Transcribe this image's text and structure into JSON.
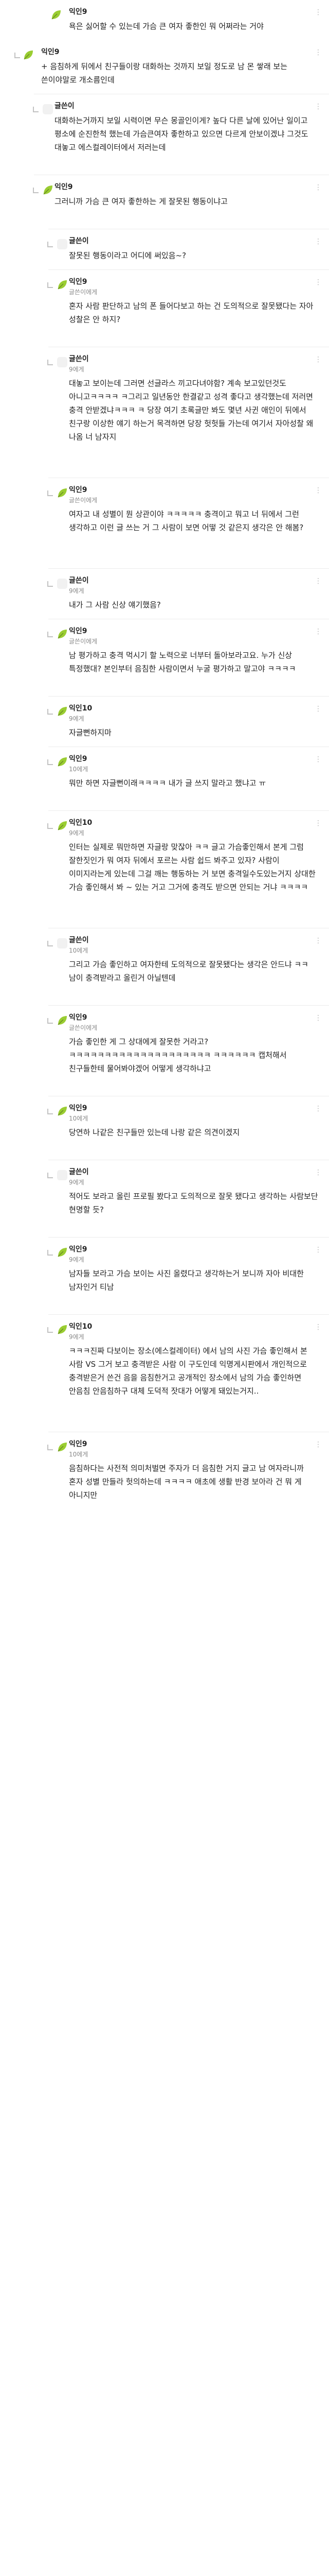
{
  "colors": {
    "avatar_green": "#9acd32",
    "avatar_yellow": "#ffd400",
    "avatar_gray": "#b8b8b8"
  },
  "comments": [
    {
      "depth": 0,
      "avatar": "leaf-avatar",
      "nick": "익인9",
      "reply_to": "",
      "body": "욕은 싫어할 수 있는데 가슴 큰 여자 좋한인 뭐 어쩌라는 거야",
      "time": "",
      "sep": false,
      "lines": 1
    },
    {
      "depth": 1,
      "avatar": "leaf-avatar",
      "nick": "익인9",
      "reply_to": "",
      "body": "+ 음침하게 뒤에서 친구들이랑 대화하는 것까지 보일 정도로 남 몬 쌓래 보는 쓴이야말로 개소름인데",
      "time": "",
      "sep": false,
      "lines": 2
    },
    {
      "depth": 2,
      "avatar": "blank-avatar",
      "nick": "글쓴이",
      "reply_to": "",
      "body": "대화하는거까지 보일 시력이면 무슨 몽골인이게? 높다 다른 날에 있어난 일이고 평소에 순진한척 했는데 가슴큰여자 좋한하고 있으면 다르게 안보이겠냐 그것도 대놓고 에스컬레이터에서 저러는데",
      "time": "",
      "sep": true,
      "lines": 4
    },
    {
      "depth": 2,
      "avatar": "leaf-avatar",
      "nick": "익인9",
      "reply_to": "",
      "body": "그러니까 가슴 큰 여자 좋한하는 게 잘못된 행동이냐고",
      "time": "",
      "sep": true,
      "lines": 2
    },
    {
      "depth": 3,
      "avatar": "blank-avatar",
      "nick": "글쓴이",
      "reply_to": "",
      "body": "잘못된 행동이라고 어디에 써있음~?",
      "time": "",
      "sep": true,
      "lines": 1
    },
    {
      "depth": 3,
      "avatar": "leaf-avatar",
      "nick": "익인9",
      "reply_to": "글쓴이에게",
      "body": "혼자 사람 판단하고 남의 폰 들어다보고 하는 건 도의적으로 잘못됐다는 자아 성찰은 안 하지?",
      "time": "",
      "sep": true,
      "lines": 3
    },
    {
      "depth": 3,
      "avatar": "blank-avatar",
      "nick": "글쓴이",
      "reply_to": "9에게",
      "body": "대놓고 보이는데 그러면 선글라스 끼고다녀야함? 계속 보고있던것도 아니고ㅋㅋㅋㅋ ㅋ그리고 일년동안 한결같고 성격 좋다고 생각했는데 저러면 충격 안받겠냐ㅋㅋㅋ ㅋ 당장 여기 초록글만 봐도 몇년 사귄 애인이 뒤에서 친구랑 이상한 얘기 하는거 목격하면 당장 헛헛들 가는데 여기서 자아성찰 왜 나옴 너 남자지",
      "time": "",
      "sep": true,
      "lines": 7
    },
    {
      "depth": 3,
      "avatar": "leaf-avatar",
      "nick": "익인9",
      "reply_to": "글쓴이에게",
      "body": "여자고 내 성별이 뭔 상관이야 ㅋㅋㅋㅋㅋ 충격이고 뭐고 너 뒤에서 그런 생각하고 이런 글 쓰는 거 그 사람이 보면 어떻 것 같은지 생각은 안 해봄?",
      "time": "",
      "sep": true,
      "lines": 4
    },
    {
      "depth": 3,
      "avatar": "blank-avatar",
      "nick": "글쓴이",
      "reply_to": "9에게",
      "body": "내가 그 사람 신상 얘기했음?",
      "time": "",
      "sep": true,
      "lines": 1
    },
    {
      "depth": 3,
      "avatar": "leaf-avatar",
      "nick": "익인9",
      "reply_to": "글쓴이에게",
      "body": "남 평가하고 충격 먹시기 할 노력으로 너부터 돌아보라고요. 누가 신상 특정했대? 본인부터 음침한 사람이면서 누굴 평가하고 말고야 ㅋㅋㅋㅋ",
      "time": "",
      "sep": true,
      "lines": 3
    },
    {
      "depth": 3,
      "avatar": "leaf-avatar",
      "nick": "익인10",
      "reply_to": "9에게",
      "body": "자글뻔하지마",
      "time": "",
      "sep": true,
      "lines": 1
    },
    {
      "depth": 3,
      "avatar": "leaf-avatar",
      "nick": "익인9",
      "reply_to": "10에게",
      "body": "뭐만 하면 자글뻔이래ㅋㅋㅋㅋ 내가 글 쓰지 말라고 했냐고 ㅠ",
      "time": "",
      "sep": true,
      "lines": 2
    },
    {
      "depth": 3,
      "avatar": "leaf-avatar",
      "nick": "익인10",
      "reply_to": "9에게",
      "body": "인터는 실제로 뭐만하면 자글랑 맞잖아 ㅋㅋ 글고 가슴좋인해서 본게 그럼 잘한짓인가 뭐 여자 뒤에서 포르는 사람 쉽드 봐주고 있자? 사람이 이미지라는게 있는데 그걸 깨는 행동하는 거 보면 충격일수도있는거지 상대한 가슴 좋인해서 봐 ~ 있는 거고 그거에 충격도 받으면 안되는 거냐 ㅋㅋㅋㅋ",
      "time": "",
      "sep": true,
      "lines": 6
    },
    {
      "depth": 3,
      "avatar": "blank-avatar",
      "nick": "글쓴이",
      "reply_to": "10에게",
      "body": "그리고 가슴 좋인하고 여자한테 도의적으로 잘못됐다는 생각은 안드냐 ㅋㅋ 남이 충격받라고 올린거 아닐텐데",
      "time": "",
      "sep": true,
      "lines": 3
    },
    {
      "depth": 3,
      "avatar": "leaf-avatar",
      "nick": "익인9",
      "reply_to": "글쓴이에게",
      "body": "가슴 좋인한 게 그 상대에게 잘못한 거라고? ㅋㅋㅋㅋㅋㅋㅋㅋㅋㅋㅋㅋㅋㅋㅋㅋㅋㅋㅋㅋ ㅋㅋㅋㅋㅋㅋ 캡처해서 친구들한테 물어봐야겠어 어떻게 생각하냐고",
      "time": "",
      "sep": true,
      "lines": 4
    },
    {
      "depth": 3,
      "avatar": "leaf-avatar",
      "nick": "익인9",
      "reply_to": "10에게",
      "body": "당연하 나같은 친구들만 있는데 나랑 같은 의견이겠지",
      "time": "",
      "sep": true,
      "lines": 2
    },
    {
      "depth": 3,
      "avatar": "blank-avatar",
      "nick": "글쓴이",
      "reply_to": "9에게",
      "body": "적어도 보라고 올린 프로필 봤다고 도의적으로 잘못 됐다고 생각하는 사람보단 현명할 듯?",
      "time": "",
      "sep": true,
      "lines": 3
    },
    {
      "depth": 3,
      "avatar": "leaf-avatar",
      "nick": "익인9",
      "reply_to": "9에게",
      "body": "남자들 보라고 가슴 보이는 사진 올렸다고 생각하는거 보니까 자아 비대한 남자인거 티남",
      "time": "",
      "sep": true,
      "lines": 3
    },
    {
      "depth": 3,
      "avatar": "leaf-avatar",
      "nick": "익인10",
      "reply_to": "9에게",
      "body": "ㅋㅋㅋ진짜 다보이는 장소(에스컬레이터) 에서 남의 사진 가슴 좋인해서 본 사람 VS 그거 보고 충격받은 사람 이 구도인데 익명게시판에서 개인적으로 충격받은거 쓴건 음을 음침한거고 공개적인 장소에서 남의 가슴 좋인하면 안음침 안음침하구 대체 도덕적 잣대가 어떻게 돼있는거지..",
      "time": "",
      "sep": true,
      "lines": 6
    },
    {
      "depth": 3,
      "avatar": "leaf-avatar",
      "nick": "익인9",
      "reply_to": "10에게",
      "body": "음침하다는 사전적 의미처벌면 주자가 더 음침한 거지 글고 남 여자라니까 혼자 성별 만들라 헛의하는데 ㅋㅋㅋㅋ 애초에 생활 반경 보아라 건 뭐 게 아니지만",
      "time": "",
      "sep": true,
      "lines": 4
    }
  ]
}
